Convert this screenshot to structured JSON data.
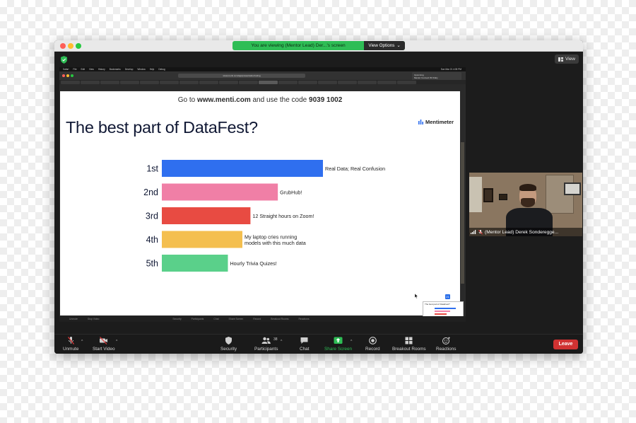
{
  "banner": {
    "viewing_text": "You are viewing (Mentor Lead) Der...'s screen",
    "view_options": "View Options"
  },
  "view_button": "View",
  "shared_screen": {
    "mac_menu": [
      "Safari",
      "File",
      "Edit",
      "View",
      "History",
      "Bookmarks",
      "Develop",
      "Window",
      "Help",
      "Debug"
    ],
    "clock": "Sun Mar 21  4:05 PM",
    "url": "www.menti.com/app/presentation/voting",
    "notification": [
      "Upcoming",
      "Mentor Connect W/ Ruby",
      "Tomorrow"
    ],
    "bottom_labels": [
      "Unmute",
      "Stop Video",
      "Security",
      "Participants",
      "Chat",
      "Share Screen",
      "Record",
      "Breakout Rooms",
      "Reactions"
    ]
  },
  "slide": {
    "instruction_prefix": "Go to ",
    "instruction_site": "www.menti.com",
    "instruction_mid": " and use the code ",
    "instruction_code": "9039 1002",
    "title": "The best part of DataFest?",
    "brand": "Mentimeter",
    "thumb_title": "The best part of DataFest?",
    "thumb_badge": "21"
  },
  "chart_data": {
    "type": "bar",
    "orientation": "horizontal",
    "categories": [
      "1st",
      "2nd",
      "3rd",
      "4th",
      "5th"
    ],
    "labels": [
      "Real Data; Real Confusion",
      "GrubHub!",
      "12 Straight hours on Zoom!",
      "My laptop cries running models with this much data",
      "Hourly Trivia Quizes!"
    ],
    "label_lines": [
      [
        "Real Data; Real Confusion"
      ],
      [
        "GrubHub!"
      ],
      [
        "12 Straight hours on Zoom!"
      ],
      [
        "My laptop cries running",
        "models with this much data"
      ],
      [
        "Hourly Trivia Quizes!"
      ]
    ],
    "values": [
      10,
      7.2,
      5.5,
      5.0,
      4.1
    ],
    "colors": [
      "#2f6fef",
      "#f07fa6",
      "#e84b42",
      "#f4bf4f",
      "#5ad08a"
    ],
    "xlim": [
      0,
      10
    ]
  },
  "participant": {
    "name": "(Mentor Lead) Derek   Sonderegge..."
  },
  "controls": {
    "unmute": "Unmute",
    "start_video": "Start Video",
    "security": "Security",
    "participants": "Participants",
    "participants_count": "38",
    "chat": "Chat",
    "share_screen": "Share Screen",
    "record": "Record",
    "breakout_rooms": "Breakout Rooms",
    "reactions": "Reactions",
    "leave": "Leave"
  },
  "colors": {
    "share_green": "#2ebd55",
    "leave_red": "#d03232"
  }
}
